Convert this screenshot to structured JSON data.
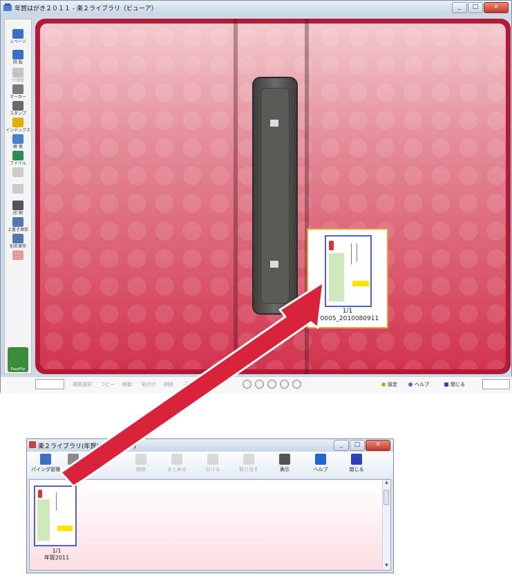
{
  "viewer": {
    "title": "年賀はがき２０１１ - 楽２ライブラリ（ビューア）",
    "window_buttons": [
      "_",
      "□",
      "×"
    ],
    "tools": [
      {
        "label": "１ページ",
        "icon": "one-page-icon",
        "enabled": true
      },
      {
        "label": "回 転",
        "icon": "rotate-icon",
        "enabled": true
      },
      {
        "label": "付箋紙",
        "icon": "sticky-note-icon",
        "enabled": false
      },
      {
        "label": "マーカー",
        "icon": "marker-icon",
        "enabled": true
      },
      {
        "label": "スタンプ",
        "icon": "stamp-icon",
        "enabled": true
      },
      {
        "label": "インデックス",
        "icon": "index-icon",
        "enabled": true
      },
      {
        "label": "検 索",
        "icon": "search-icon",
        "enabled": true
      },
      {
        "label": "ファイル",
        "icon": "file-icon",
        "enabled": true
      },
      {
        "label": "",
        "icon": "edit-icon",
        "enabled": false
      },
      {
        "label": "",
        "icon": "send-icon",
        "enabled": false
      },
      {
        "label": "印 刷",
        "icon": "print-icon",
        "enabled": true
      },
      {
        "label": "上書き保存",
        "icon": "save-icon",
        "enabled": true
      },
      {
        "label": "別名保存",
        "icon": "save-as-icon",
        "enabled": true
      },
      {
        "label": "",
        "icon": "stamp-seal-icon",
        "enabled": false
      }
    ],
    "brand": "EasyFlip",
    "card": {
      "page": "1/1",
      "name": "00005_2010080911"
    },
    "status": {
      "items": [
        "複数選択",
        "コピー",
        "移動",
        "貼付け",
        "削除",
        "元"
      ],
      "nav_buttons": [
        "first",
        "prev",
        "stop",
        "next",
        "last"
      ],
      "right": [
        {
          "label": "設定",
          "color": "#d4a017"
        },
        {
          "label": "ヘルプ",
          "color": "#3b6fd1"
        },
        {
          "label": "閉じる",
          "color": "#2a44b8"
        }
      ]
    }
  },
  "desk": {
    "title": "楽２ライブラリ(年賀はがきデスク)",
    "toolbar": [
      {
        "label": "バインダ管理",
        "icon": "binder-manage-icon",
        "enabled": true
      },
      {
        "label": "操作",
        "icon": "operate-icon",
        "enabled": true
      },
      {
        "label": "削除",
        "icon": "delete-icon",
        "enabled": false
      },
      {
        "label": "まとめる",
        "icon": "merge-icon",
        "enabled": false
      },
      {
        "label": "分ける",
        "icon": "split-icon",
        "enabled": false
      },
      {
        "label": "取り出す",
        "icon": "extract-icon",
        "enabled": false
      },
      {
        "label": "表示",
        "icon": "view-icon",
        "enabled": true
      },
      {
        "label": "ヘルプ",
        "icon": "help-icon",
        "enabled": true
      },
      {
        "label": "閉じる",
        "icon": "close-icon",
        "enabled": true
      }
    ],
    "item": {
      "page": "1/1",
      "name": "年賀2011"
    }
  },
  "colors": {
    "binder": "#b21b35",
    "arrow": "#d9233a",
    "card_border": "#f09a2e"
  }
}
